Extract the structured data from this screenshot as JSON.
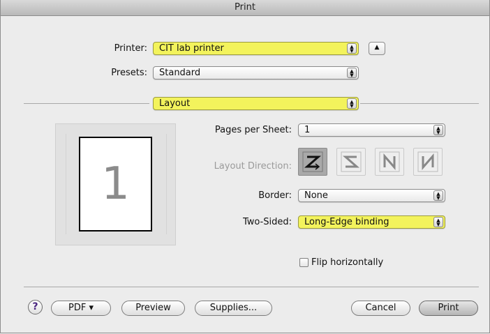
{
  "window": {
    "title": "Print"
  },
  "printer": {
    "label": "Printer:",
    "value": "CIT lab printer",
    "highlight_color": "#f3f35c"
  },
  "presets": {
    "label": "Presets:",
    "value": "Standard"
  },
  "section": {
    "value": "Layout"
  },
  "layout": {
    "pages_per_sheet": {
      "label": "Pages per Sheet:",
      "value": "1"
    },
    "layout_direction": {
      "label": "Layout Direction:",
      "options": [
        "Z",
        "S-reversed",
        "N-reversed",
        "N"
      ],
      "selected_index": 0
    },
    "border": {
      "label": "Border:",
      "value": "None"
    },
    "two_sided": {
      "label": "Two-Sided:",
      "value": "Long-Edge binding"
    },
    "flip": {
      "label": "Flip horizontally",
      "checked": false
    }
  },
  "preview": {
    "page_number": "1"
  },
  "footer": {
    "help": "?",
    "pdf": "PDF ▾",
    "preview": "Preview",
    "supplies": "Supplies...",
    "cancel": "Cancel",
    "print": "Print"
  }
}
